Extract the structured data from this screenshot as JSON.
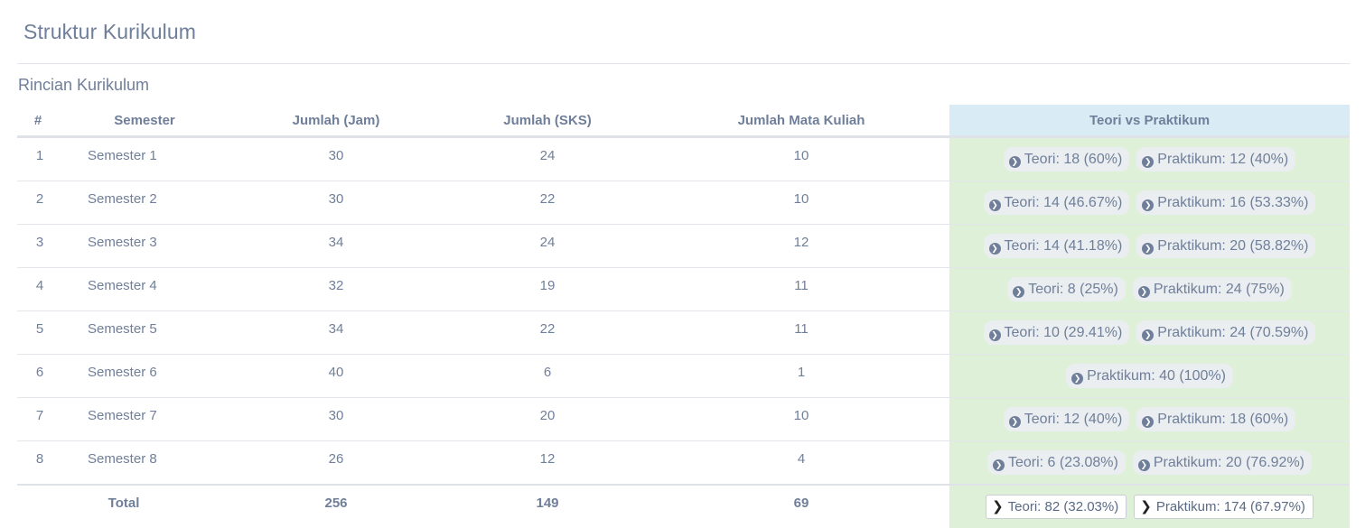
{
  "page": {
    "title": "Struktur Kurikulum"
  },
  "section": {
    "title": "Rincian Kurikulum"
  },
  "table": {
    "headers": {
      "no": "#",
      "semester": "Semester",
      "jam": "Jumlah (Jam)",
      "sks": "Jumlah (SKS)",
      "mk": "Jumlah Mata Kuliah",
      "tp": "Teori vs Praktikum"
    },
    "rows": [
      {
        "no": "1",
        "semester": "Semester 1",
        "jam": "30",
        "sks": "24",
        "mk": "10",
        "teori": "Teori: 18 (60%)",
        "praktikum": "Praktikum: 12 (40%)"
      },
      {
        "no": "2",
        "semester": "Semester 2",
        "jam": "30",
        "sks": "22",
        "mk": "10",
        "teori": "Teori: 14 (46.67%)",
        "praktikum": "Praktikum: 16 (53.33%)"
      },
      {
        "no": "3",
        "semester": "Semester 3",
        "jam": "34",
        "sks": "24",
        "mk": "12",
        "teori": "Teori: 14 (41.18%)",
        "praktikum": "Praktikum: 20 (58.82%)"
      },
      {
        "no": "4",
        "semester": "Semester 4",
        "jam": "32",
        "sks": "19",
        "mk": "11",
        "teori": "Teori: 8 (25%)",
        "praktikum": "Praktikum: 24 (75%)"
      },
      {
        "no": "5",
        "semester": "Semester 5",
        "jam": "34",
        "sks": "22",
        "mk": "11",
        "teori": "Teori: 10 (29.41%)",
        "praktikum": "Praktikum: 24 (70.59%)"
      },
      {
        "no": "6",
        "semester": "Semester 6",
        "jam": "40",
        "sks": "6",
        "mk": "1",
        "teori": "",
        "praktikum": "Praktikum: 40 (100%)"
      },
      {
        "no": "7",
        "semester": "Semester 7",
        "jam": "30",
        "sks": "20",
        "mk": "10",
        "teori": "Teori: 12 (40%)",
        "praktikum": "Praktikum: 18 (60%)"
      },
      {
        "no": "8",
        "semester": "Semester 8",
        "jam": "26",
        "sks": "12",
        "mk": "4",
        "teori": "Teori: 6 (23.08%)",
        "praktikum": "Praktikum: 20 (76.92%)"
      }
    ],
    "total": {
      "label": "Total",
      "jam": "256",
      "sks": "149",
      "mk": "69",
      "teori": "Teori: 82 (32.03%)",
      "praktikum": "Praktikum: 174 (67.97%)"
    }
  },
  "icons": {
    "badge_icon": "chevron-circle-right-icon",
    "total_icon": "chevron-right-icon"
  },
  "colors": {
    "text": "#6f7f9a",
    "header_highlight": "#d9ebf5",
    "tp_column_bg": "#dff0d8",
    "badge_bg": "#eaeef1"
  }
}
